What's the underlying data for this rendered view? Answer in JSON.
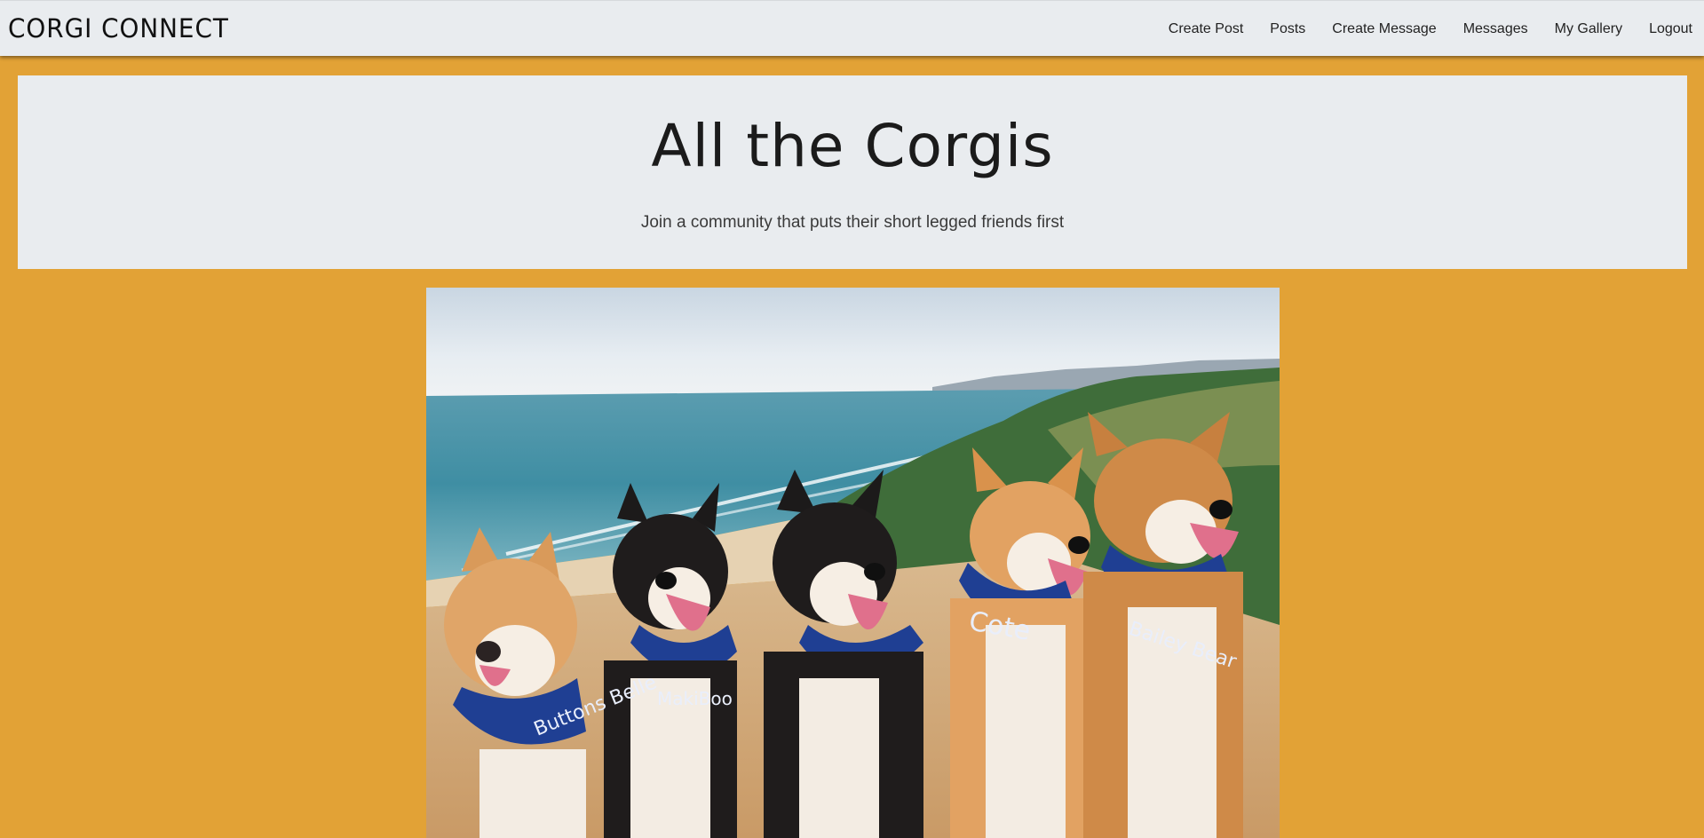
{
  "navbar": {
    "brand": "CORGI CONNECT",
    "links": [
      {
        "label": "Create Post"
      },
      {
        "label": "Posts"
      },
      {
        "label": "Create Message"
      },
      {
        "label": "Messages"
      },
      {
        "label": "My Gallery"
      },
      {
        "label": "Logout"
      }
    ]
  },
  "hero": {
    "title": "All the Corgis",
    "subtitle": "Join a community that puts their short legged friends first"
  },
  "photo": {
    "bandanas": [
      "Buttons Belle",
      "MakiBoo",
      "Cote",
      "Bailey Bear"
    ]
  },
  "colors": {
    "page_background": "#e2a236",
    "navbar_background": "#e9ecef",
    "hero_background": "#e9ecef"
  }
}
